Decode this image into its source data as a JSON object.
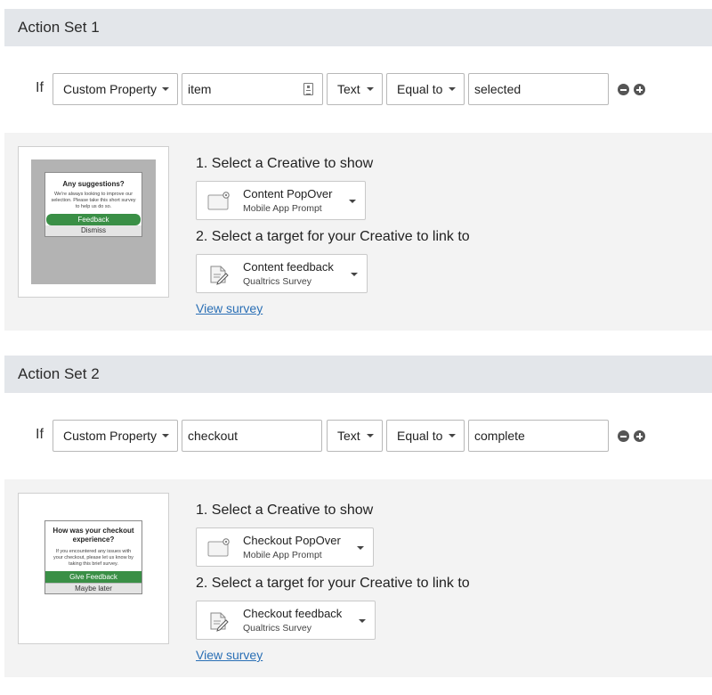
{
  "action_sets": [
    {
      "header": "Action Set 1",
      "condition": {
        "if_label": "If",
        "property_type": "Custom Property",
        "property_name": "item",
        "value_type": "Text",
        "operator": "Equal to",
        "value": "selected"
      },
      "preview": {
        "title": "Any suggestions?",
        "body": "We're always looking to improve our selection. Please take this short survey to help us do so.",
        "primary_button": "Feedback",
        "secondary_button": "Dismiss"
      },
      "step1_label": "1. Select a Creative to show",
      "creative": {
        "name": "Content PopOver",
        "type": "Mobile App Prompt"
      },
      "step2_label": "2. Select a target for your Creative to link to",
      "target": {
        "name": "Content feedback",
        "type": "Qualtrics Survey"
      },
      "view_link": "View survey"
    },
    {
      "header": "Action Set 2",
      "condition": {
        "if_label": "If",
        "property_type": "Custom Property",
        "property_name": "checkout",
        "value_type": "Text",
        "operator": "Equal to",
        "value": "complete"
      },
      "preview": {
        "title": "How was your checkout experience?",
        "body": "If you encountered any issues with your checkout, please let us know by taking this brief survey.",
        "primary_button": "Give Feedback",
        "secondary_button": "Maybe later"
      },
      "step1_label": "1. Select a Creative to show",
      "creative": {
        "name": "Checkout PopOver",
        "type": "Mobile App Prompt"
      },
      "step2_label": "2. Select a target for your Creative to link to",
      "target": {
        "name": "Checkout feedback",
        "type": "Qualtrics Survey"
      },
      "view_link": "View survey"
    }
  ],
  "icons": {
    "remove": "minus-circle-icon",
    "add": "plus-circle-icon",
    "creative": "popover-icon",
    "target": "survey-icon",
    "piped_text": "piped-text-icon"
  },
  "colors": {
    "header_bg": "#e3e6ea",
    "panel_bg": "#f3f3f3",
    "link": "#2a6fb5",
    "feedback_green": "#3a8f46"
  }
}
